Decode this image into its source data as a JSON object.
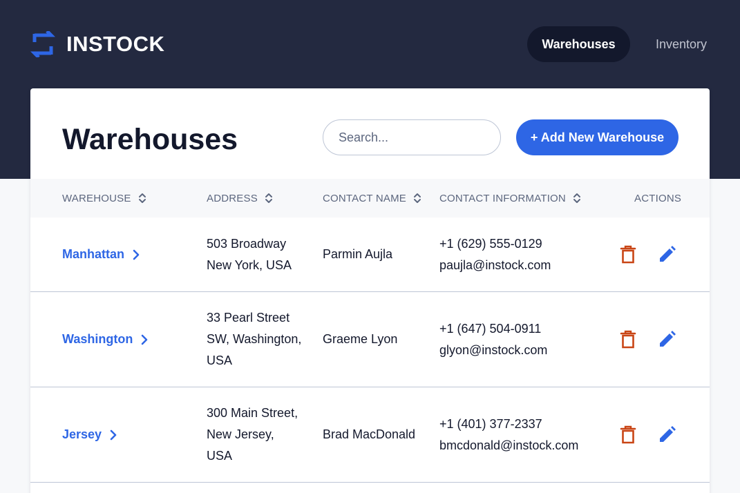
{
  "app": {
    "name": "INSTOCK",
    "nav": [
      {
        "label": "Warehouses",
        "active": true
      },
      {
        "label": "Inventory",
        "active": false
      }
    ]
  },
  "page": {
    "title": "Warehouses",
    "search_placeholder": "Search...",
    "add_button_label": "+ Add New Warehouse"
  },
  "table": {
    "columns": [
      "WAREHOUSE",
      "ADDRESS",
      "CONTACT NAME",
      "CONTACT INFORMATION",
      "ACTIONS"
    ],
    "rows": [
      {
        "warehouse": "Manhattan",
        "address": [
          "503 Broadway",
          "New York, USA"
        ],
        "contact_name": "Parmin Aujla",
        "phone": "+1 (629) 555-0129",
        "email": "paujla@instock.com"
      },
      {
        "warehouse": "Washington",
        "address": [
          "33 Pearl Street",
          "SW, Washington,",
          "USA"
        ],
        "contact_name": "Graeme Lyon",
        "phone": "+1 (647) 504-0911",
        "email": "glyon@instock.com"
      },
      {
        "warehouse": "Jersey",
        "address": [
          "300 Main Street,",
          "New Jersey,",
          "USA"
        ],
        "contact_name": "Brad MacDonald",
        "phone": "+1 (401) 377-2337",
        "email": "bmcdonald@instock.com"
      }
    ]
  },
  "colors": {
    "header_bg": "#232940",
    "accent_blue": "#2e66e5",
    "delete_red": "#c94515",
    "dark_text": "#13182c",
    "muted_text": "#5c667e"
  },
  "icons": [
    "swap-arrows-icon",
    "search-icon",
    "sort-icon",
    "chevron-right-icon",
    "trash-icon",
    "edit-pencil-icon"
  ]
}
